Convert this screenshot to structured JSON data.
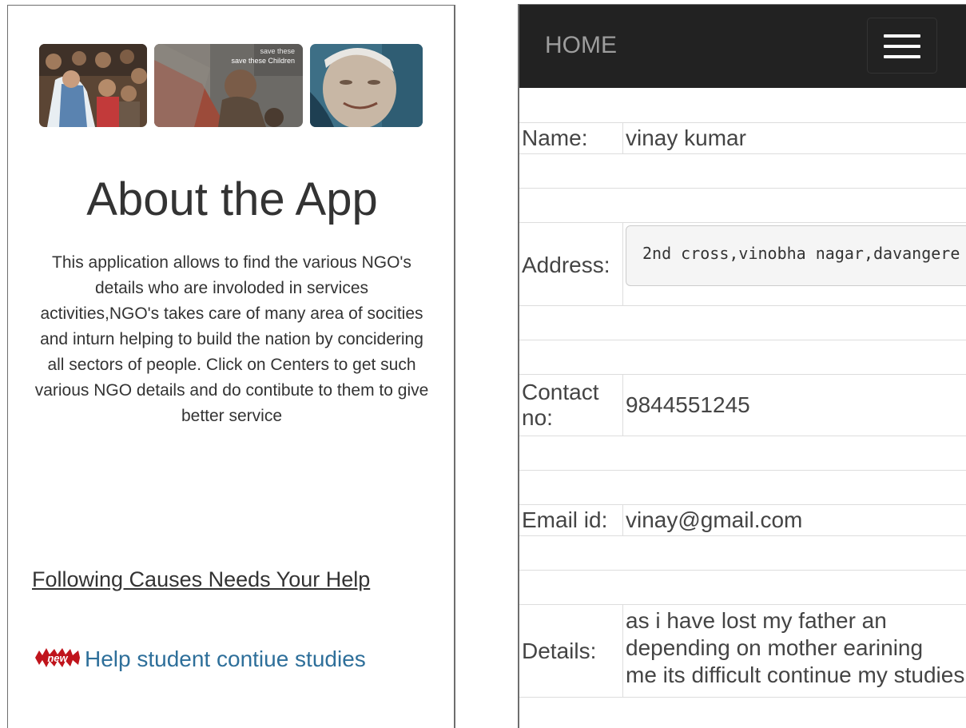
{
  "about": {
    "title": "About the App",
    "image_caption": "save these Children",
    "description": "This application allows to find the various NGO's details who are involoded in services activities,NGO's takes care of many area of socities and inturn helping to build the nation by concidering all sectors of people. Click on Centers to get such various NGO details and do contibute to them to give better service",
    "causes_heading": "Following Causes Needs Your Help",
    "new_badge": "new",
    "cause_link": "Help student contiue studies"
  },
  "navbar": {
    "home_label": "HOME",
    "toggle_icon": "hamburger-menu-icon",
    "background": "#222222",
    "home_color": "#9d9d9d"
  },
  "details": {
    "name_label": "Name:",
    "name_value": "vinay kumar",
    "address_label": "Address:",
    "address_value": "2nd cross,vinobha nagar,davangere",
    "contact_label_line1": "Contact",
    "contact_label_line2": "no:",
    "contact_value": "9844551245",
    "email_label": "Email id:",
    "email_value": "vinay@gmail.com",
    "details_label": "Details:",
    "details_line1": "as i have lost my father an",
    "details_line2": "depending on mother earining",
    "details_line3": "me its difficult continue my studies"
  },
  "colors": {
    "link": "#2e6f9a",
    "text": "#333333",
    "badge": "#c0141c"
  }
}
